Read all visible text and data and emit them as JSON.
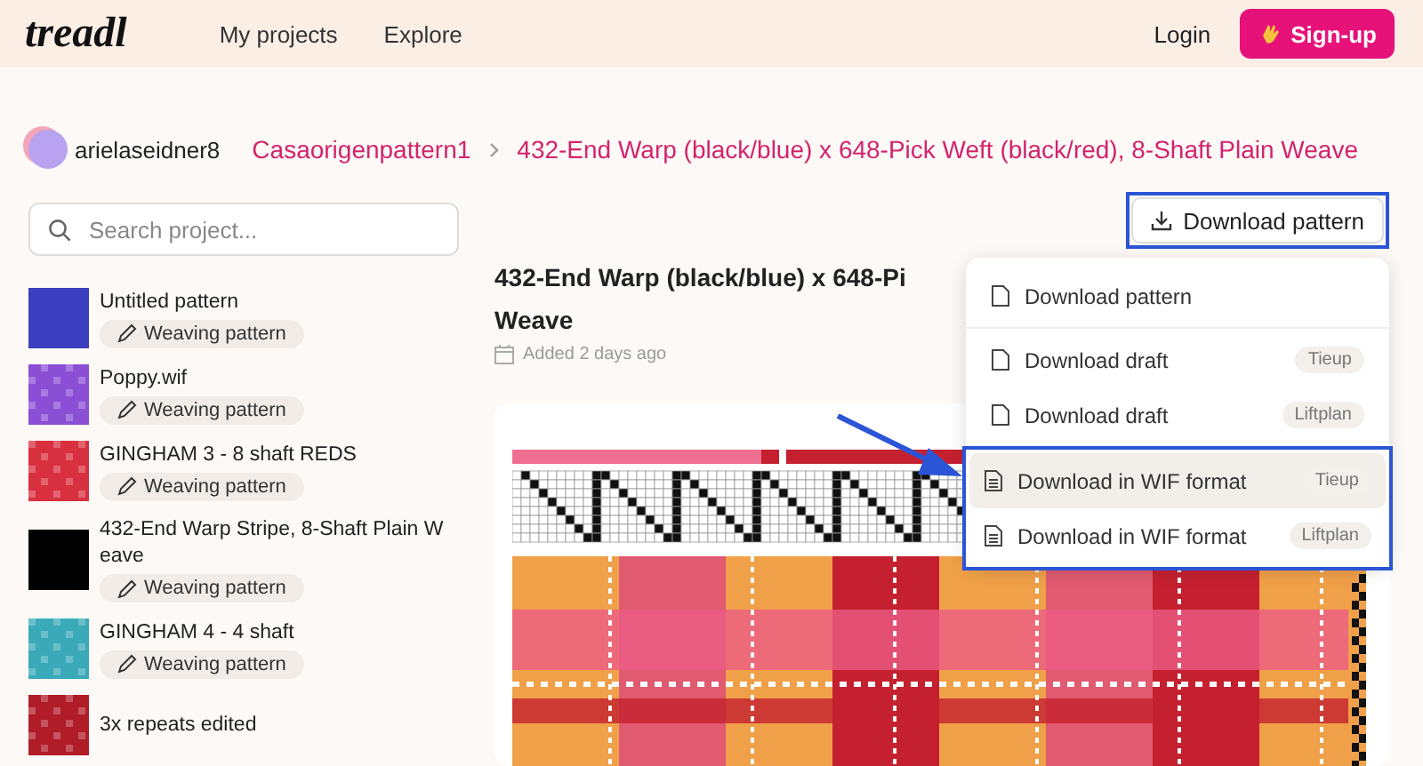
{
  "header": {
    "logo": "treadl",
    "nav": [
      "My projects",
      "Explore"
    ],
    "login": "Login",
    "signup": "Sign-up"
  },
  "breadcrumb": {
    "user": "arielaseidner8",
    "items": [
      "Casaorigenpattern1",
      "432-End Warp (black/blue) x 648-Pick Weft (black/red), 8-Shaft Plain Weave"
    ]
  },
  "search": {
    "placeholder": "Search project..."
  },
  "projects": [
    {
      "name": "Untitled pattern",
      "tag": "Weaving pattern",
      "color": "#3b3fbf"
    },
    {
      "name": "Poppy.wif",
      "tag": "Weaving pattern",
      "color": "#8b4fd6"
    },
    {
      "name": "GINGHAM 3 - 8 shaft REDS",
      "tag": "Weaving pattern",
      "color": "#d8303f"
    },
    {
      "name": "432-End Warp Stripe, 8-Shaft Plain W eave",
      "tag": "Weaving pattern",
      "color": "#000000"
    },
    {
      "name": "GINGHAM 4 - 4 shaft",
      "tag": "Weaving pattern",
      "color": "#3aaab8"
    },
    {
      "name": "3x repeats edited",
      "color": "#b01c28"
    }
  ],
  "download_button": "Download pattern",
  "title_lines": [
    "432-End Warp (black/blue) x 648-Pi",
    "Weave"
  ],
  "added": "Added 2 days ago",
  "menu": {
    "sections": [
      [
        {
          "label": "Download pattern",
          "kind": "plain",
          "selected": false
        }
      ],
      [
        {
          "label": "Download draft",
          "badge": "Tieup",
          "kind": "plain",
          "selected": false
        },
        {
          "label": "Download draft",
          "badge": "Liftplan",
          "kind": "plain",
          "selected": false
        }
      ],
      [
        {
          "label": "Download in WIF format",
          "badge": "Tieup",
          "kind": "wif",
          "selected": true
        },
        {
          "label": "Download in WIF format",
          "badge": "Liftplan",
          "kind": "wif",
          "selected": false
        }
      ]
    ]
  }
}
